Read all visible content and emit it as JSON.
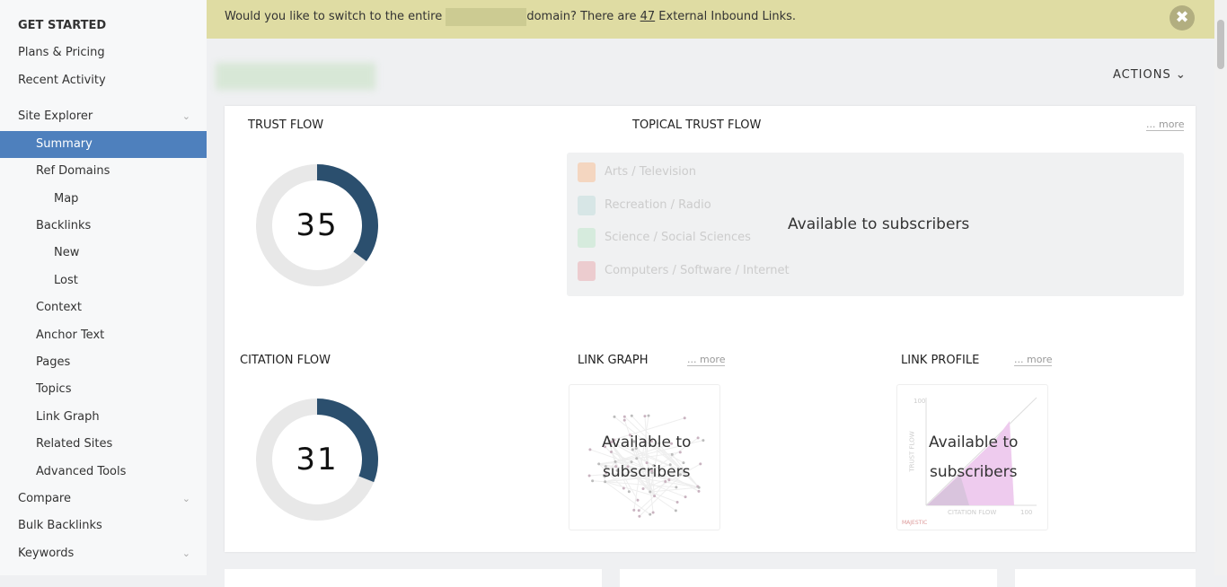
{
  "sidebar": {
    "items": [
      {
        "label": "GET STARTED"
      },
      {
        "label": "Plans & Pricing"
      },
      {
        "label": "Recent Activity"
      },
      {
        "label": "Site Explorer"
      },
      {
        "label": "Summary"
      },
      {
        "label": "Ref Domains"
      },
      {
        "label": "Map"
      },
      {
        "label": "Backlinks"
      },
      {
        "label": "New"
      },
      {
        "label": "Lost"
      },
      {
        "label": "Context"
      },
      {
        "label": "Anchor Text"
      },
      {
        "label": "Pages"
      },
      {
        "label": "Topics"
      },
      {
        "label": "Link Graph"
      },
      {
        "label": "Related Sites"
      },
      {
        "label": "Advanced Tools"
      },
      {
        "label": "Compare"
      },
      {
        "label": "Bulk Backlinks"
      },
      {
        "label": "Keywords"
      }
    ]
  },
  "banner": {
    "text_before": "Would you like to switch to the entire",
    "text_mid": "domain? There are",
    "link_count": "47",
    "text_after": "External Inbound Links."
  },
  "actions_label": "ACTIONS",
  "trust_flow": {
    "title": "TRUST FLOW",
    "value": "35",
    "fraction": 0.35,
    "color": "#2b4f6e"
  },
  "citation_flow": {
    "title": "CITATION FLOW",
    "value": "31",
    "fraction": 0.31,
    "color": "#2b4f6e"
  },
  "topical": {
    "title": "TOPICAL TRUST FLOW",
    "more": "... more",
    "overlay": "Available to subscribers",
    "topics": [
      {
        "label": "Arts / Television",
        "color": "#f4d6c0"
      },
      {
        "label": "Recreation / Radio",
        "color": "#d7e6e6"
      },
      {
        "label": "Science / Social Sciences",
        "color": "#d6ebdd"
      },
      {
        "label": "Computers / Software / Internet",
        "color": "#eccccf"
      }
    ]
  },
  "link_graph": {
    "title": "LINK GRAPH",
    "more": "... more",
    "overlay_1": "Available to",
    "overlay_2": "subscribers"
  },
  "link_profile": {
    "title": "LINK PROFILE",
    "more": "... more",
    "overlay_1": "Available to",
    "overlay_2": "subscribers",
    "y_axis": "TRUST FLOW",
    "x_axis": "CITATION FLOW",
    "y_max": "100",
    "x_max": "100",
    "brand": "MAJESTIC"
  }
}
